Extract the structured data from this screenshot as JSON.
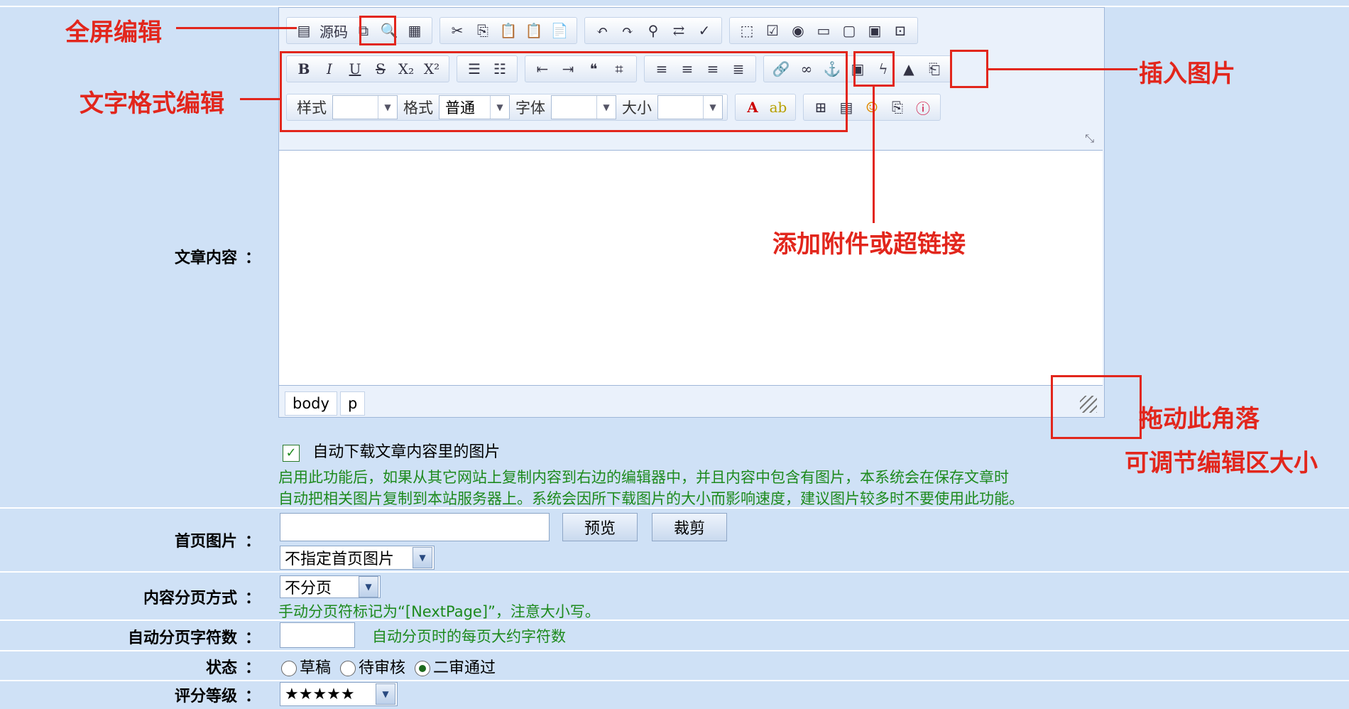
{
  "toolbar": {
    "row1": [
      "源码"
    ],
    "row2_format": [
      "B",
      "I",
      "U",
      "S",
      "X₂",
      "X²"
    ],
    "row3": {
      "style_label": "样式",
      "format_label": "格式",
      "format_value": "普通",
      "font_label": "字体",
      "size_label": "大小"
    }
  },
  "editor": {
    "path_items": [
      "body",
      "p"
    ]
  },
  "form": {
    "article_content_label": "文章内容",
    "colon": "：",
    "auto_download_checked": true,
    "auto_download_label": "自动下载文章内容里的图片",
    "auto_download_help_1": "启用此功能后，如果从其它网站上复制内容到右边的编辑器中，并且内容中包含有图片，本系统会在保存文章时",
    "auto_download_help_2": "自动把相关图片复制到本站服务器上。系统会因所下载图片的大小而影响速度，建议图片较多时不要使用此功能。",
    "home_image_label": "首页图片",
    "preview_button": "预览",
    "crop_button": "裁剪",
    "home_image_select": "不指定首页图片",
    "pagination_label": "内容分页方式",
    "pagination_select": "不分页",
    "pagination_help": "手动分页符标记为“[NextPage]”，注意大小写。",
    "auto_page_chars_label": "自动分页字符数",
    "auto_page_chars_help": "自动分页时的每页大约字符数",
    "status_label": "状态",
    "status_options": [
      "草稿",
      "待审核",
      "二审通过"
    ],
    "status_selected": "二审通过",
    "rating_label": "评分等级",
    "rating_value": "★★★★★"
  },
  "annotations": {
    "fullscreen": "全屏编辑",
    "text_format": "文字格式编辑",
    "insert_image": "插入图片",
    "attachment_link": "添加附件或超链接",
    "drag_corner": "拖动此角落",
    "resize_area": "可调节编辑区大小"
  },
  "colors": {
    "page_bg": "#cfe1f6",
    "annotation_red": "#e2261c",
    "help_green": "#1d8a1d"
  }
}
